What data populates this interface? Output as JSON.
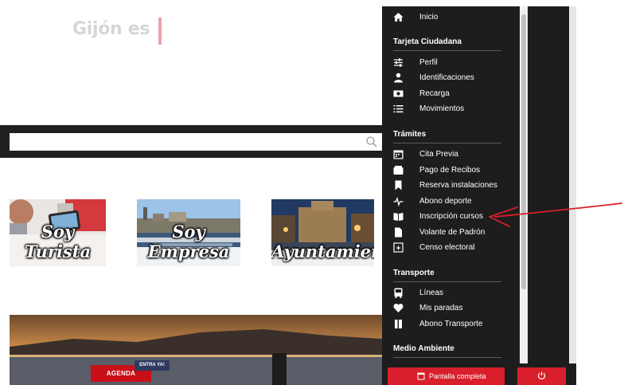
{
  "header": {
    "brand": "Gijón es"
  },
  "search": {
    "placeholder": ""
  },
  "cards": [
    {
      "label": "Soy Turista"
    },
    {
      "label": "Soy Empresa"
    },
    {
      "label": "Ayuntamiento"
    }
  ],
  "banner": {
    "agenda_label": "AGENDA",
    "badge_label": "ENTRA YA!"
  },
  "menu": {
    "top_item": {
      "label": "Inicio",
      "icon": "home-icon"
    },
    "sections": [
      {
        "title": "Tarjeta Ciudadana",
        "items": [
          {
            "label": "Perfil",
            "icon": "sliders-icon"
          },
          {
            "label": "Identificaciones",
            "icon": "user-icon"
          },
          {
            "label": "Recarga",
            "icon": "money-icon"
          },
          {
            "label": "Movimientos",
            "icon": "list-icon"
          }
        ]
      },
      {
        "title": "Trámites",
        "items": [
          {
            "label": "Cita Previa",
            "icon": "calendar-icon"
          },
          {
            "label": "Pago de Recibos",
            "icon": "wallet-icon"
          },
          {
            "label": "Reserva instalaciones",
            "icon": "bookmark-icon"
          },
          {
            "label": "Abono deporte",
            "icon": "heartbeat-icon"
          },
          {
            "label": "Inscripción cursos",
            "icon": "book-icon"
          },
          {
            "label": "Volante de Padrón",
            "icon": "file-icon"
          },
          {
            "label": "Censo electoral",
            "icon": "ballot-icon"
          }
        ]
      },
      {
        "title": "Transporte",
        "items": [
          {
            "label": "Líneas",
            "icon": "bus-icon"
          },
          {
            "label": "Mis paradas",
            "icon": "heart-icon"
          },
          {
            "label": "Abono Transporte",
            "icon": "ticket-icon"
          }
        ]
      },
      {
        "title": "Medio Ambiente",
        "items": []
      }
    ]
  },
  "footer": {
    "fullscreen_label": "Pantalla completa",
    "power_icon": "power-icon"
  },
  "colors": {
    "panel_bg": "#1d1d1d",
    "accent_red": "#d81f2b",
    "annotation_red": "#d9202a"
  }
}
